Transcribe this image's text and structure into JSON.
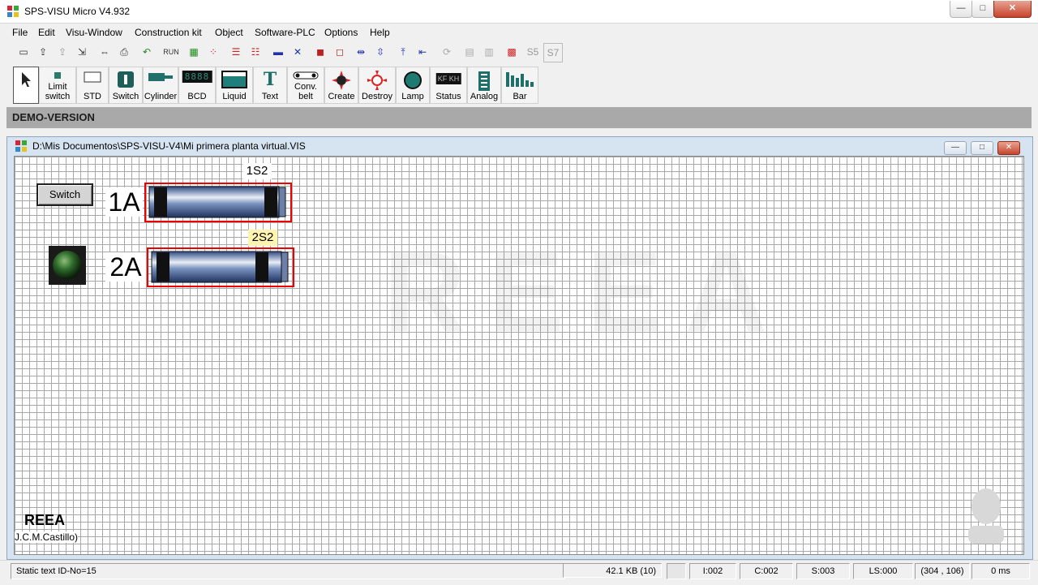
{
  "window": {
    "title": "SPS-VISU Micro V4.932",
    "minimize": "—",
    "maximize": "□",
    "close": "✕"
  },
  "menu": [
    "File",
    "Edit",
    "Visu-Window",
    "Construction kit",
    "Object",
    "Software-PLC",
    "Options",
    "Help"
  ],
  "toolbar1": {
    "run": "RUN",
    "s5": "S5",
    "s7": "S7"
  },
  "toolbox": [
    {
      "label": "",
      "icon": "pointer-icon"
    },
    {
      "label": "Limit switch",
      "icon": "limit-switch-icon"
    },
    {
      "label": "STD",
      "icon": "std-icon"
    },
    {
      "label": "Switch",
      "icon": "switch-icon"
    },
    {
      "label": "Cylinder",
      "icon": "cylinder-icon"
    },
    {
      "label": "BCD",
      "icon": "bcd-icon"
    },
    {
      "label": "Liquid",
      "icon": "liquid-icon"
    },
    {
      "label": "Text",
      "icon": "text-icon"
    },
    {
      "label": "Conv. belt",
      "icon": "conveyor-belt-icon"
    },
    {
      "label": "Create",
      "icon": "create-icon"
    },
    {
      "label": "Destroy",
      "icon": "destroy-icon"
    },
    {
      "label": "Lamp",
      "icon": "lamp-icon"
    },
    {
      "label": "Status",
      "icon": "status-icon"
    },
    {
      "label": "Analog",
      "icon": "analog-icon"
    },
    {
      "label": "Bar",
      "icon": "bar-icon"
    }
  ],
  "toolbox_glyphs": {
    "bcd": "8888",
    "text": "T",
    "status": "KF KH"
  },
  "demo_band": "DEMO-VERSION",
  "document": {
    "path": "D:\\Mis Documentos\\SPS-VISU-V4\\Mi primera planta virtual.VIS",
    "minimize": "—",
    "maximize": "□",
    "close": "✕"
  },
  "canvas": {
    "switch_label": "Switch",
    "cyl1_label": "1A",
    "cyl1_sensor": "1S2",
    "cyl2_label": "2A",
    "cyl2_sensor": "2S2",
    "watermark": "REEA",
    "brand": "REEA",
    "author": "(J.C.M.Castillo)"
  },
  "statusbar": {
    "info": "Static text ID-No=15",
    "size": "42.1 KB (10)",
    "i": "I:002",
    "c": "C:002",
    "s": "S:003",
    "ls": "LS:000",
    "coords": "(304 , 106)",
    "time": "0 ms"
  },
  "colors": {
    "accent_red": "#e00000",
    "demo_band": "#a9a9a9",
    "lamp_off": "#2e6b2a"
  }
}
